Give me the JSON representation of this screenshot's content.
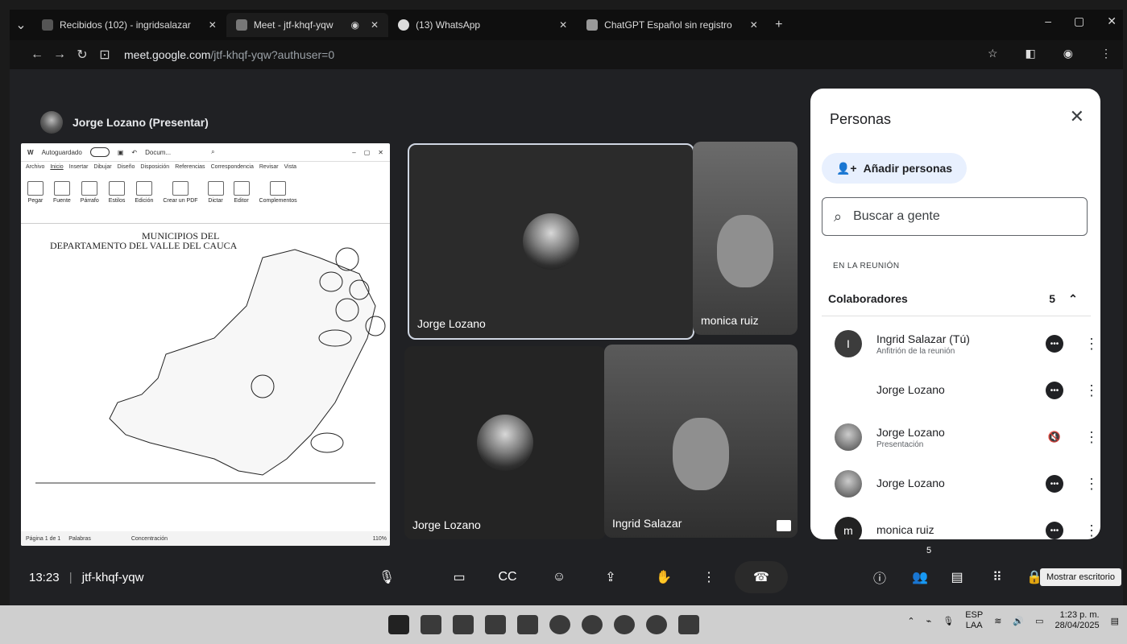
{
  "browser": {
    "tabs": [
      {
        "label": "Recibidos (102) - ingridsalazar"
      },
      {
        "label": "Meet - jtf-khqf-yqw"
      },
      {
        "label": "(13) WhatsApp"
      },
      {
        "label": "ChatGPT Español sin registro"
      }
    ],
    "url_host": "meet.google.com",
    "url_path": "/jtf-khqf-yqw?authuser=0"
  },
  "presenter": {
    "title": "Jorge Lozano (Presentar)"
  },
  "document": {
    "autosave": "Autoguardado",
    "filename": "Docum...",
    "menu": [
      "Archivo",
      "Inicio",
      "Insertar",
      "Dibujar",
      "Diseño",
      "Disposición",
      "Referencias",
      "Correspondencia",
      "Revisar",
      "Vista"
    ],
    "ribbon": [
      "Pegar",
      "Fuente",
      "Párrafo",
      "Estilos",
      "Edición",
      "Crear un PDF",
      "Dictar",
      "Editor",
      "Complementos"
    ],
    "map_title_1": "MUNICIPIOS DEL",
    "map_title_2": "DEPARTAMENTO DEL VALLE DEL CAUCA",
    "status": [
      "Página 1 de 1",
      "Palabras",
      "Concentración",
      "110%"
    ]
  },
  "tiles": [
    {
      "name": "Jorge Lozano"
    },
    {
      "name": "monica ruiz"
    },
    {
      "name": "Jorge Lozano"
    },
    {
      "name": "Ingrid Salazar"
    }
  ],
  "panel": {
    "title": "Personas",
    "add_people": "Añadir personas",
    "search_placeholder": "Buscar a gente",
    "section": "EN LA REUNIÓN",
    "group_label": "Colaboradores",
    "group_count": "5",
    "people": [
      {
        "name": "Ingrid Salazar (Tú)",
        "sub": "Anfitrión de la reunión",
        "initial": "I"
      },
      {
        "name": "Jorge Lozano",
        "sub": "",
        "initial": ""
      },
      {
        "name": "Jorge Lozano",
        "sub": "Presentación",
        "initial": ""
      },
      {
        "name": "Jorge Lozano",
        "sub": "",
        "initial": ""
      },
      {
        "name": "monica ruiz",
        "sub": "",
        "initial": "m"
      }
    ]
  },
  "controls": {
    "time": "13:23",
    "meeting_code": "jtf-khqf-yqw",
    "people_count": "5",
    "tooltip": "Mostrar escritorio"
  },
  "taskbar": {
    "lang_1": "ESP",
    "lang_2": "LAA",
    "clock_time": "1:23 p. m.",
    "clock_date": "28/04/2025"
  }
}
